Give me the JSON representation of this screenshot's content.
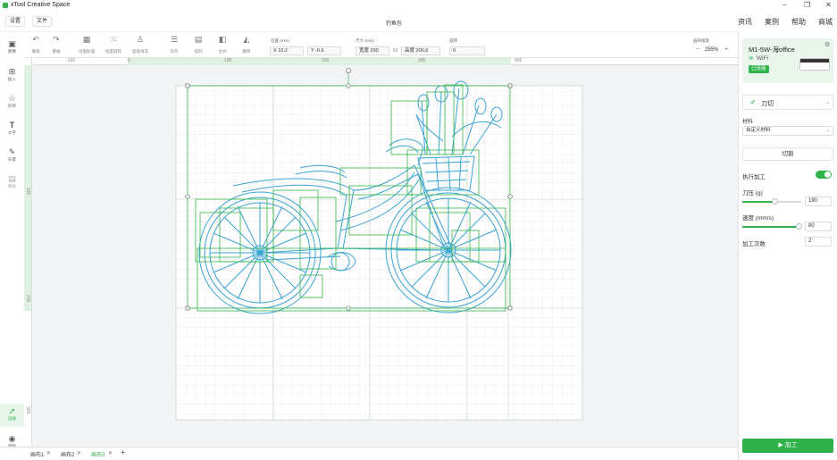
{
  "window": {
    "title": "xTool Creative Space"
  },
  "menu": {
    "settings": "设置",
    "file": "文件",
    "doc_name": "钓鱼包"
  },
  "topnav": {
    "news": "资讯",
    "cases": "案例",
    "help": "帮助",
    "store": "商城"
  },
  "toolbar": {
    "undo": "撤销",
    "redo": "重做",
    "bitmap": "位图处理",
    "batch": "批量圆阵",
    "smart_fill": "智能填充",
    "align": "对齐",
    "arrange": "排列",
    "combine": "合并",
    "flip": "翻转",
    "position_label": "位置 (mm)",
    "x_value": "X 10.2",
    "y_value": "Y -0.6",
    "size_label": "尺寸 (mm)",
    "width_value": "宽度 290",
    "height_value": "高度 200.6",
    "rotate_label": "旋转",
    "rotate_value": "0",
    "zoom_label": "画布缩放",
    "zoom_value": "255%",
    "minus": "−",
    "plus": "+"
  },
  "lefttools": {
    "image": "图像",
    "insert": "插入",
    "shape": "形状",
    "text": "文字",
    "vector": "矢量",
    "template": "模板",
    "select": "选择",
    "assist": "辅助"
  },
  "ruler": {
    "h": [
      "-100",
      "0",
      "100",
      "200",
      "300",
      "400"
    ],
    "v": [
      "100",
      "200",
      "300"
    ]
  },
  "tabs": {
    "t1": "画布1",
    "t2": "画布2",
    "t3": "画布3",
    "add": "+"
  },
  "device": {
    "name": "M1-5W-海office",
    "conn": "WiFi",
    "status": "已连接"
  },
  "panel": {
    "process_mode": "刀切",
    "material_label": "材料",
    "material_value": "自定义材料",
    "cut_tab": "切割",
    "execute_label": "执行加工",
    "pressure_label": "刀压 (g)",
    "pressure_value": "190",
    "pressure_ratio": 0.55,
    "speed_label": "速度 (mm/s)",
    "speed_value": "80",
    "speed_ratio": 0.95,
    "passes_label": "加工次数",
    "passes_value": "2",
    "process_button": "加工"
  },
  "colors": {
    "accent": "#2fb24a",
    "vector_blue": "#3aa3d4",
    "vector_green": "#35b84a"
  }
}
